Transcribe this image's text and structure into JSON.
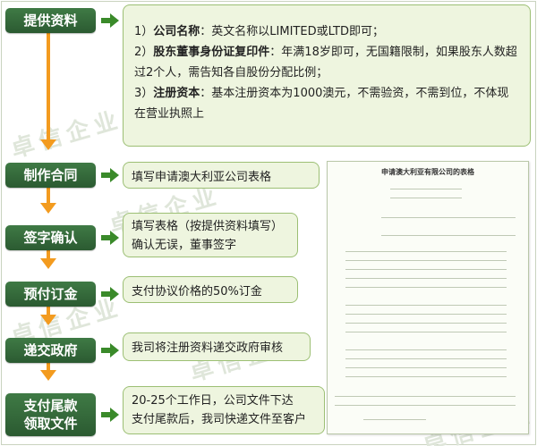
{
  "steps": [
    {
      "label": "提供资料"
    },
    {
      "label": "制作合同"
    },
    {
      "label": "签字确认"
    },
    {
      "label": "预付订金"
    },
    {
      "label": "递交政府"
    },
    {
      "label_line1": "支付尾款",
      "label_line2": "领取文件"
    }
  ],
  "info": {
    "item1_prefix": "1）",
    "item1_title": "公司名称",
    "item1_text": "：英文名称以LIMITED或LTD即可；",
    "item2_prefix": "2）",
    "item2_title": "股东董事身份证复印件",
    "item2_text": "：年满18岁即可，无国籍限制，如果股东人数超过2个人，需告知各自股份分配比例；",
    "item3_prefix": "3）",
    "item3_title": "注册资本",
    "item3_text": "：基本注册资本为1000澳元，不需验资，不需到位，不体现在营业执照上"
  },
  "details": [
    {
      "text1": "填写申请澳大利亚公司表格"
    },
    {
      "text1": "填写表格（按提供资料填写）",
      "text2": "确认无误，董事签字"
    },
    {
      "text1": "支付协议价格的50%订金"
    },
    {
      "text1": "我司将注册资料递交政府审核"
    },
    {
      "text1": "20-25个工作日，公司文件下达",
      "text2": "支付尾款后，我司快递文件至客户"
    }
  ],
  "document": {
    "title": "申请澳大利亚有限公司的表格"
  },
  "watermark": "卓信企业",
  "colors": {
    "step_bg": "#2f6236",
    "arrow_orange": "#f39b1f",
    "arrow_green": "#3a8a2a",
    "box_bg": "#eef5df",
    "box_border": "#9cbf74"
  }
}
